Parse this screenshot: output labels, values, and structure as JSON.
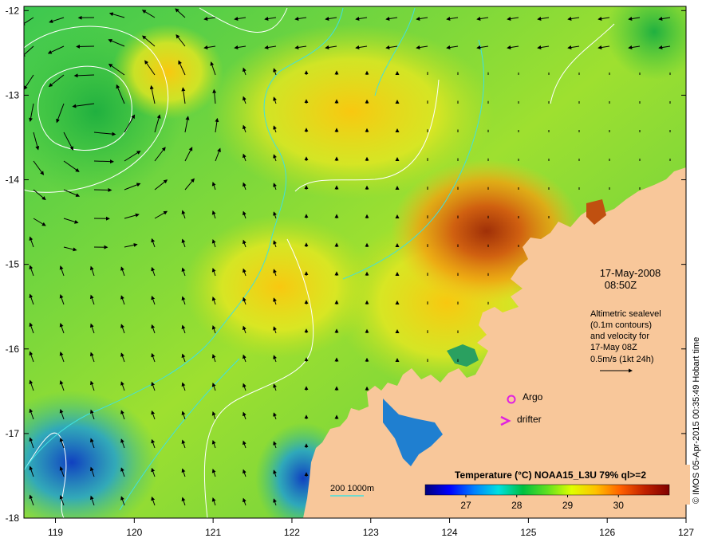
{
  "map": {
    "lon_ticks": [
      "119",
      "120",
      "121",
      "122",
      "123",
      "124",
      "125",
      "126",
      "127"
    ],
    "lat_ticks": [
      "-12",
      "-13",
      "-14",
      "-15",
      "-16",
      "-17",
      "-18"
    ],
    "date": "17-May-2008",
    "time": "08:50Z",
    "info_lines": [
      "Altimetric sealevel",
      "(0.1m contours)",
      "and velocity for",
      "17-May 08Z"
    ],
    "scale_label": "0.5m/s (1kt 24h)",
    "argo_label": "Argo",
    "drifter_label": "drifter",
    "depth_label": "200  1000m",
    "colorbar_title": "Temperature (°C) NOAA15_L3U 79% ql>=2",
    "colorbar_ticks": [
      "27",
      "28",
      "29",
      "30"
    ],
    "colorbar_range": [
      26.2,
      31.0
    ],
    "side_credit": "© IMOS 05-Apr-2015 00:35:49 Hobart time",
    "colors": {
      "land": "#f8c79a",
      "argo": "#e020e0",
      "drifter": "#e020e0",
      "contour_depth": "#40e0e0",
      "sealevel_contour": "#ffffff",
      "colorbar_stops": [
        "#00007a",
        "#0000ff",
        "#0080ff",
        "#00e0e0",
        "#00c040",
        "#60e020",
        "#e0ff00",
        "#ffc000",
        "#ff6000",
        "#c02000",
        "#800000"
      ]
    }
  }
}
